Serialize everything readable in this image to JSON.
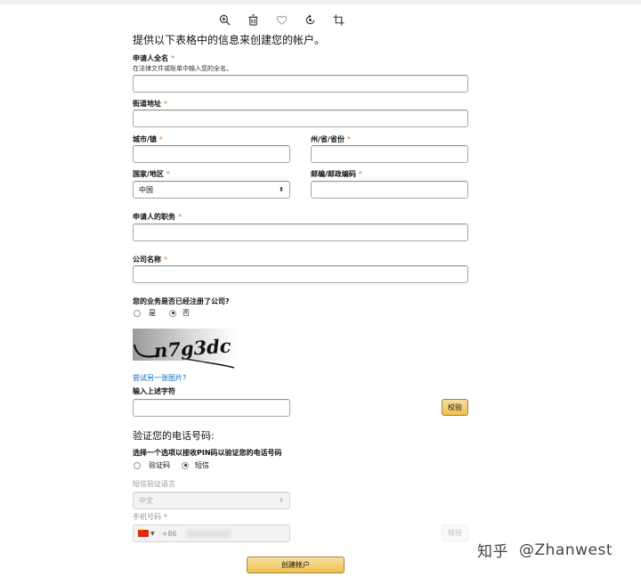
{
  "intro": "提供以下表格中的信息来创建您的帐户。",
  "required_mark": "*",
  "fields": {
    "full_name": {
      "label": "申请人全名",
      "hint": "在法律文件或账单中输入您的全名。",
      "value": ""
    },
    "street": {
      "label": "街道地址",
      "value": ""
    },
    "city": {
      "label": "城市/镇",
      "value": ""
    },
    "state": {
      "label": "州/省/省份",
      "value": ""
    },
    "country": {
      "label": "国家/地区",
      "value": "中国"
    },
    "postal": {
      "label": "邮编/邮政编码",
      "value": ""
    },
    "title": {
      "label": "申请人的职务",
      "value": ""
    },
    "company": {
      "label": "公司名称",
      "value": ""
    }
  },
  "business_question": {
    "label": "您的业务是否已经注册了公司?",
    "options": [
      "是",
      "否"
    ],
    "selected": "否"
  },
  "captcha": {
    "text": "n7g3dc",
    "retry_link": "尝试另一张图片?",
    "input_label": "输入上述字符",
    "verify_button": "校验"
  },
  "phone_section": {
    "title": "验证您的电话号码:",
    "method_label": "选择一个选项以接收PIN码以验证您的电话号码",
    "options": [
      "验证码",
      "短信"
    ],
    "selected": "短信",
    "language_label": "短信验证语言",
    "language_value": "中文",
    "phone_label": "手机号码",
    "country_code": "+86",
    "verify_button": "校验"
  },
  "submit_button": "创建帐户",
  "watermark": {
    "site": "知乎",
    "user": "@Zhanwest"
  },
  "icons": [
    "zoom-in-icon",
    "trash-icon",
    "heart-icon",
    "rotate-icon",
    "crop-icon"
  ]
}
